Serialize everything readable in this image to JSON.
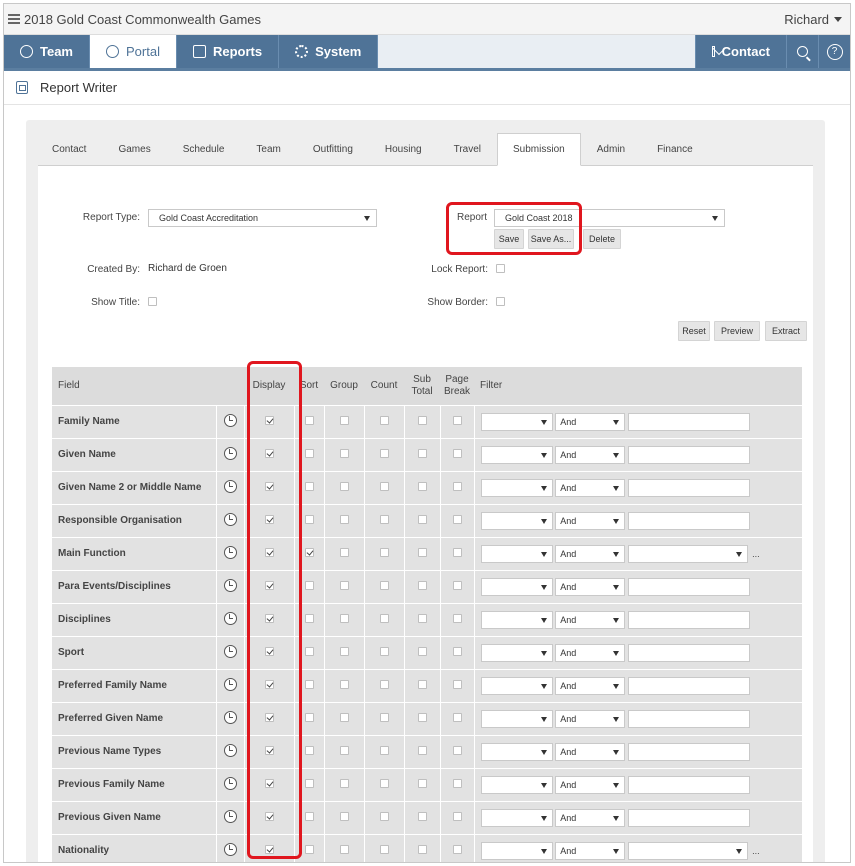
{
  "app": {
    "title": "2018 Gold Coast Commonwealth Games",
    "user": "Richard"
  },
  "nav": {
    "tabs": [
      {
        "label": "Team",
        "icon": "team-icon"
      },
      {
        "label": "Portal",
        "icon": "globe-icon"
      },
      {
        "label": "Reports",
        "icon": "reports-icon"
      },
      {
        "label": "System",
        "icon": "gear-icon"
      }
    ],
    "contact": "Contact",
    "help": "?"
  },
  "page": {
    "title": "Report Writer"
  },
  "tabs": [
    "Contact",
    "Games",
    "Schedule",
    "Team",
    "Outfitting",
    "Housing",
    "Travel",
    "Submission",
    "Admin",
    "Finance"
  ],
  "active_tab": "Submission",
  "form": {
    "report_type_label": "Report Type:",
    "report_type_value": "Gold Coast Accreditation",
    "report_label": "Report",
    "report_value": "Gold Coast 2018",
    "save": "Save",
    "save_as": "Save As...",
    "delete": "Delete",
    "created_by_label": "Created By:",
    "created_by_value": "Richard de Groen",
    "lock_report_label": "Lock Report:",
    "show_title_label": "Show Title:",
    "show_border_label": "Show Border:",
    "reset": "Reset",
    "preview": "Preview",
    "extract": "Extract"
  },
  "grid": {
    "headers": {
      "field": "Field",
      "display": "Display",
      "sort": "Sort",
      "group": "Group",
      "count": "Count",
      "sub_total": "Sub Total",
      "page_break": "Page Break",
      "filter": "Filter"
    },
    "rows": [
      {
        "name": "Family Name",
        "display": true,
        "sort": false,
        "and": "And",
        "wide": false
      },
      {
        "name": "Given Name",
        "display": true,
        "sort": false,
        "and": "And",
        "wide": false
      },
      {
        "name": "Given Name 2 or Middle Name",
        "display": true,
        "sort": false,
        "and": "And",
        "wide": false
      },
      {
        "name": "Responsible Organisation",
        "display": true,
        "sort": false,
        "and": "And",
        "wide": false
      },
      {
        "name": "Main Function",
        "display": true,
        "sort": true,
        "and": "And",
        "wide": true
      },
      {
        "name": "Para Events/Disciplines",
        "display": true,
        "sort": false,
        "and": "And",
        "wide": false
      },
      {
        "name": "Disciplines",
        "display": true,
        "sort": false,
        "and": "And",
        "wide": false
      },
      {
        "name": "Sport",
        "display": true,
        "sort": false,
        "and": "And",
        "wide": false
      },
      {
        "name": "Preferred Family Name",
        "display": true,
        "sort": false,
        "and": "And",
        "wide": false
      },
      {
        "name": "Preferred Given Name",
        "display": true,
        "sort": false,
        "and": "And",
        "wide": false
      },
      {
        "name": "Previous Name Types",
        "display": true,
        "sort": false,
        "and": "And",
        "wide": false
      },
      {
        "name": "Previous Family Name",
        "display": true,
        "sort": false,
        "and": "And",
        "wide": false
      },
      {
        "name": "Previous Given Name",
        "display": true,
        "sort": false,
        "and": "And",
        "wide": false
      },
      {
        "name": "Nationality",
        "display": true,
        "sort": false,
        "and": "And",
        "wide": true
      }
    ],
    "ellipsis": "..."
  },
  "colors": {
    "nav": "#4f7397",
    "highlight": "#e0161e",
    "panel": "#eeeeee",
    "grid_row": "#e2e2e2"
  }
}
